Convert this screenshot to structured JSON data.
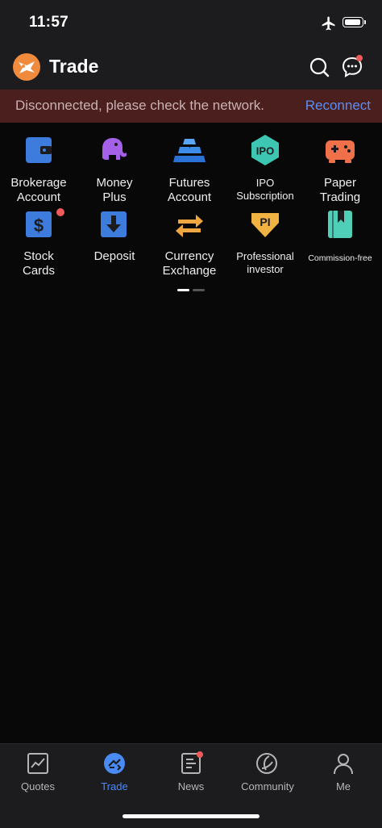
{
  "status_bar": {
    "time": "11:57"
  },
  "header": {
    "title": "Trade"
  },
  "banner": {
    "message": "Disconnected, please check the network.",
    "action": "Reconnect"
  },
  "grid": {
    "row1": [
      {
        "label_line1": "Brokerage",
        "label_line2": "Account",
        "icon": "wallet-icon"
      },
      {
        "label_line1": "Money",
        "label_line2": "Plus",
        "icon": "elephant-icon"
      },
      {
        "label_line1": "Futures",
        "label_line2": "Account",
        "icon": "gold-bars-icon"
      },
      {
        "label_line1": "IPO",
        "label_line2": "Subscription",
        "icon": "ipo-icon",
        "icon_text": "IPO"
      },
      {
        "label_line1": "Paper",
        "label_line2": "Trading",
        "icon": "gamepad-icon"
      }
    ],
    "row2": [
      {
        "label_line1": "Stock",
        "label_line2": "Cards",
        "icon": "stock-card-icon"
      },
      {
        "label_line1": "Deposit",
        "label_line2": "",
        "icon": "deposit-icon"
      },
      {
        "label_line1": "Currency",
        "label_line2": "Exchange",
        "icon": "exchange-icon"
      },
      {
        "label_line1": "Professional",
        "label_line2": "investor",
        "icon": "pi-badge-icon",
        "icon_text": "PI"
      },
      {
        "label_line1": "Commission-free",
        "label_line2": "",
        "icon": "bookmark-book-icon"
      }
    ]
  },
  "pager": {
    "pages": 2,
    "current": 1
  },
  "tabs": [
    {
      "label": "Quotes",
      "icon": "chart-icon",
      "active": false
    },
    {
      "label": "Trade",
      "icon": "trade-icon",
      "active": true
    },
    {
      "label": "News",
      "icon": "news-icon",
      "active": false
    },
    {
      "label": "Community",
      "icon": "community-icon",
      "active": false
    },
    {
      "label": "Me",
      "icon": "user-icon",
      "active": false
    }
  ],
  "colors": {
    "accent": "#4a8af4",
    "alert": "#f05a5a",
    "banner_bg": "#4c1f1f",
    "brand": "#f08a3c"
  }
}
